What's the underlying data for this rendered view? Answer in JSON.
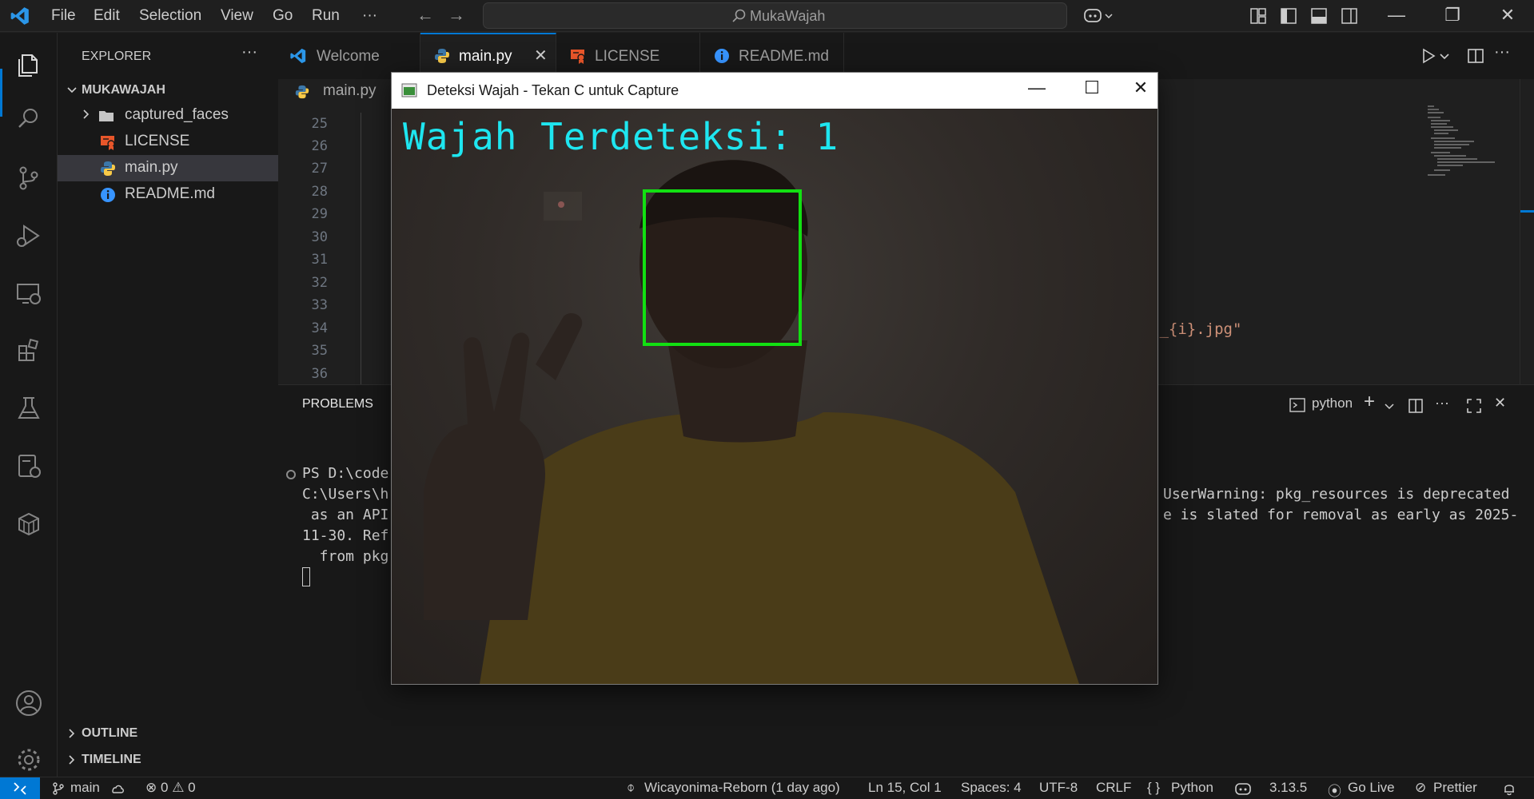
{
  "titlebar": {
    "menu": [
      "File",
      "Edit",
      "Selection",
      "View",
      "Go",
      "Run",
      "···"
    ],
    "search_label": "MukaWajah"
  },
  "sidebar": {
    "header": "EXPLORER",
    "more": "···",
    "root": "MUKAWAJAH",
    "items": [
      {
        "label": "captured_faces",
        "type": "folder"
      },
      {
        "label": "LICENSE",
        "type": "license"
      },
      {
        "label": "main.py",
        "type": "python"
      },
      {
        "label": "README.md",
        "type": "info"
      }
    ],
    "outline": "OUTLINE",
    "timeline": "TIMELINE"
  },
  "tabs": [
    {
      "label": "Welcome"
    },
    {
      "label": "main.py",
      "close": "✕"
    },
    {
      "label": "LICENSE"
    },
    {
      "label": "README.md"
    }
  ],
  "editor": {
    "breadcrumb": "main.py",
    "line_numbers": [
      "25",
      "26",
      "27",
      "28",
      "29",
      "30",
      "31",
      "32",
      "33",
      "34",
      "35",
      "36"
    ],
    "code_fragment": "}_{i}.jpg\""
  },
  "panel": {
    "tab": "PROBLEMS",
    "terminal_name": "python",
    "left_lines": [
      "PS D:\\code",
      "C:\\Users\\h",
      " as an API",
      "11-30. Ref",
      "  from pkg"
    ],
    "right_lines": [
      "UserWarning: pkg_resources is deprecated",
      "e is slated for removal as early as 2025-"
    ]
  },
  "statusbar": {
    "branch": "main",
    "errors": "0",
    "warnings": "0",
    "blame": "Wicayonima-Reborn (1 day ago)",
    "position": "Ln 15, Col 1",
    "spaces": "Spaces: 4",
    "encoding": "UTF-8",
    "eol": "CRLF",
    "language": "Python",
    "python_version": "3.13.5",
    "go_live": "Go Live",
    "prettier": "Prettier"
  },
  "cv_window": {
    "title": "Deteksi Wajah - Tekan C untuk Capture",
    "overlay_text": "Wajah Terdeteksi: 1"
  },
  "colors": {
    "accent": "#0078d4",
    "face_box": "#12e012",
    "overlay_text": "#1ee6f0"
  }
}
